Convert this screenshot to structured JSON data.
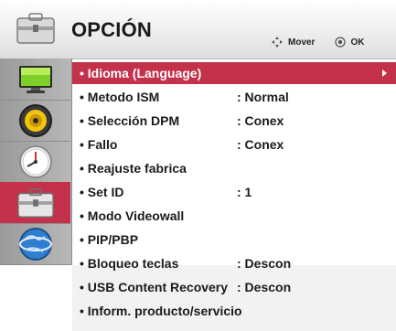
{
  "header": {
    "title": "OPCIÓN",
    "icon": "toolbox-icon",
    "hints": {
      "move_label": "Mover",
      "ok_label": "OK"
    }
  },
  "sidebar": {
    "items": [
      {
        "icon": "monitor-icon",
        "active": false
      },
      {
        "icon": "speaker-icon",
        "active": false
      },
      {
        "icon": "clock-icon",
        "active": false
      },
      {
        "icon": "toolbox-icon",
        "active": true
      },
      {
        "icon": "globe-icon",
        "active": false
      }
    ]
  },
  "menu": {
    "items": [
      {
        "label": "• Idioma (Language)",
        "value": "",
        "selected": true
      },
      {
        "label": "• Metodo ISM",
        "value": ": Normal"
      },
      {
        "label": "• Selección DPM",
        "value": ": Conex"
      },
      {
        "label": "• Fallo",
        "value": ": Conex"
      },
      {
        "label": "• Reajuste fabrica",
        "value": ""
      },
      {
        "label": "• Set ID",
        "value": ": 1"
      },
      {
        "label": "• Modo Videowall",
        "value": ""
      },
      {
        "label": "• PIP/PBP",
        "value": ""
      },
      {
        "label": "• Bloqueo teclas",
        "value": ": Descon"
      },
      {
        "label": "• USB Content Recovery",
        "value": ": Descon"
      },
      {
        "label": "• Inform. producto/servicio",
        "value": ""
      }
    ]
  },
  "colors": {
    "accent": "#c4314b",
    "sidebar": "#a8a8a8"
  }
}
